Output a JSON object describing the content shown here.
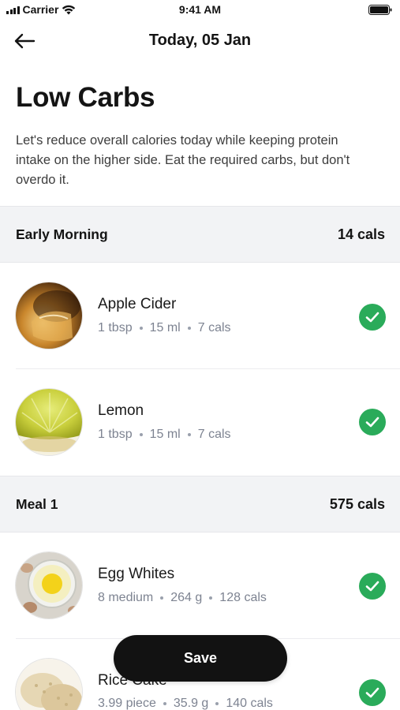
{
  "status_bar": {
    "carrier": "Carrier",
    "time": "9:41 AM"
  },
  "header": {
    "title": "Today, 05 Jan"
  },
  "main": {
    "title": "Low Carbs",
    "description": "Let's reduce overall calories today while keeping protein intake on the higher side. Eat the required carbs, but don't overdo it."
  },
  "sections": [
    {
      "title": "Early Morning",
      "cals": "14 cals",
      "items": [
        {
          "name": "Apple Cider",
          "qty": "1 tbsp",
          "weight": "15 ml",
          "cals": "7 cals",
          "checked": true
        },
        {
          "name": "Lemon",
          "qty": "1 tbsp",
          "weight": "15 ml",
          "cals": "7 cals",
          "checked": true
        }
      ]
    },
    {
      "title": "Meal 1",
      "cals": "575 cals",
      "items": [
        {
          "name": "Egg Whites",
          "qty": "8 medium",
          "weight": "264 g",
          "cals": "128 cals",
          "checked": true
        },
        {
          "name": "Rice Cake",
          "qty": "3.99 piece",
          "weight": "35.9 g",
          "cals": "140 cals",
          "checked": true
        }
      ]
    }
  ],
  "actions": {
    "save_label": "Save"
  },
  "colors": {
    "check_green": "#2aab5a",
    "section_bg": "#f2f3f5",
    "save_bg": "#121212"
  }
}
